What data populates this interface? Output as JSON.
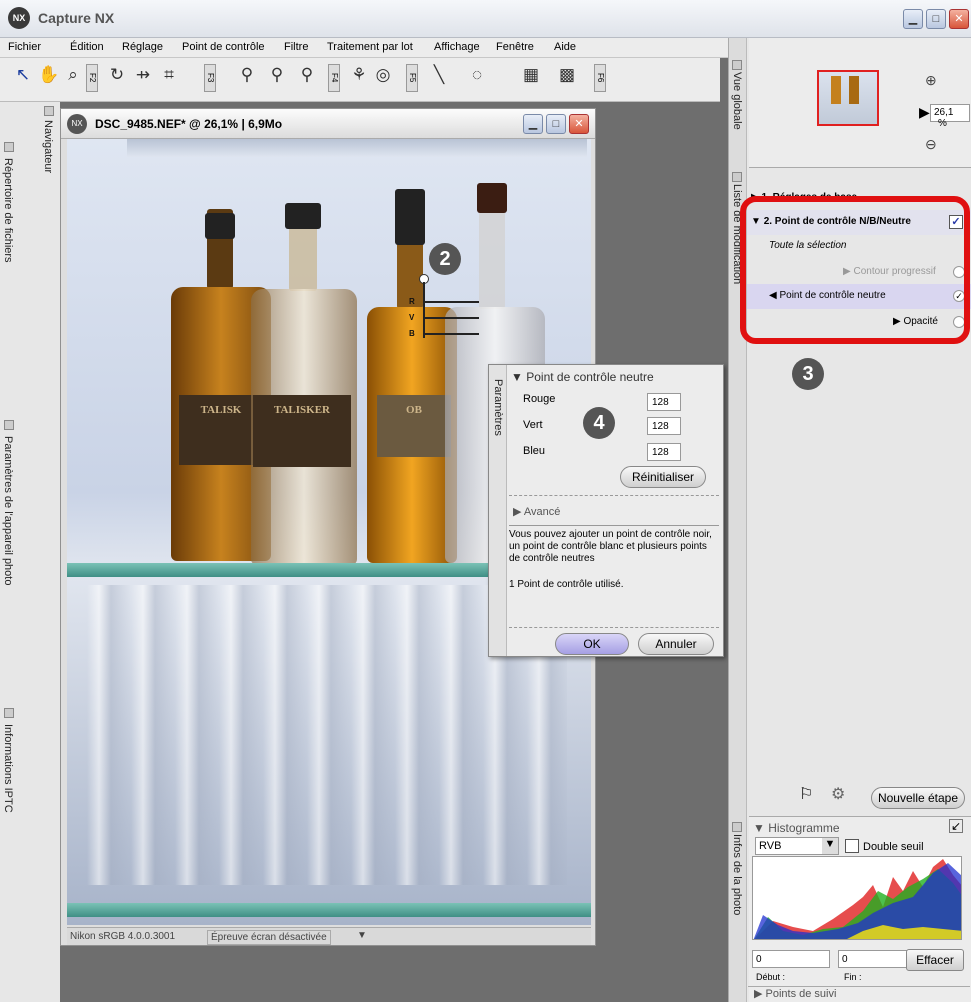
{
  "window": {
    "title": "Capture NX",
    "logo": "NX"
  },
  "menu": [
    "Fichier",
    "Édition",
    "Réglage",
    "Point de contrôle",
    "Filtre",
    "Traitement par lot",
    "Affichage",
    "Fenêtre",
    "Aide"
  ],
  "toolbar": {
    "f_labels": [
      "F2",
      "F3",
      "F4",
      "F5",
      "F6"
    ]
  },
  "left_panels": [
    "Répertoire de fichiers",
    "Paramètres de l'appareil photo",
    "Informations IPTC"
  ],
  "navigator_tab": "Navigateur",
  "image_window": {
    "title": "DSC_9485.NEF* @ 26,1% | 6,9Mo",
    "status_profile": "Nikon sRGB 4.0.0.3001",
    "status_proof": "Épreuve écran désactivée",
    "bottle_labels": [
      "TALISK",
      "TALISKER",
      "OB"
    ],
    "cp_labels": [
      "R",
      "V",
      "B"
    ]
  },
  "annotations": [
    "2",
    "3",
    "4"
  ],
  "params_dialog": {
    "side_label": "Paramètres",
    "header": "Point de contrôle neutre",
    "fields": [
      {
        "label": "Rouge",
        "value": "128"
      },
      {
        "label": "Vert",
        "value": "128"
      },
      {
        "label": "Bleu",
        "value": "128"
      }
    ],
    "reset": "Réinitialiser",
    "advanced": "Avancé",
    "help": "Vous pouvez ajouter un point de contrôle noir, un point de contrôle blanc et plusieurs points de contrôle neutres",
    "used": "1 Point de contrôle utilisé.",
    "ok": "OK",
    "cancel": "Annuler"
  },
  "right_panel": {
    "overview_tab": "Vue globale",
    "zoom_value": "26,1",
    "zoom_unit": "%",
    "steps_tab": "Liste de modification",
    "step1": "1. Réglages de base",
    "step2": "2. Point de contrôle N/B/Neutre",
    "selection": "Toute la sélection",
    "contour": "Contour progressif",
    "neutral_point": "Point de contrôle neutre",
    "opacity": "Opacité",
    "new_step": "Nouvelle étape",
    "info_tab": "Infos de la photo",
    "histogram": "Histogramme",
    "hist_channel": "RVB",
    "double_threshold": "Double seuil",
    "start_val": "0",
    "end_val": "0",
    "start_label": "Début :",
    "end_label": "Fin :",
    "clear": "Effacer",
    "tracking": "Points de suivi"
  }
}
